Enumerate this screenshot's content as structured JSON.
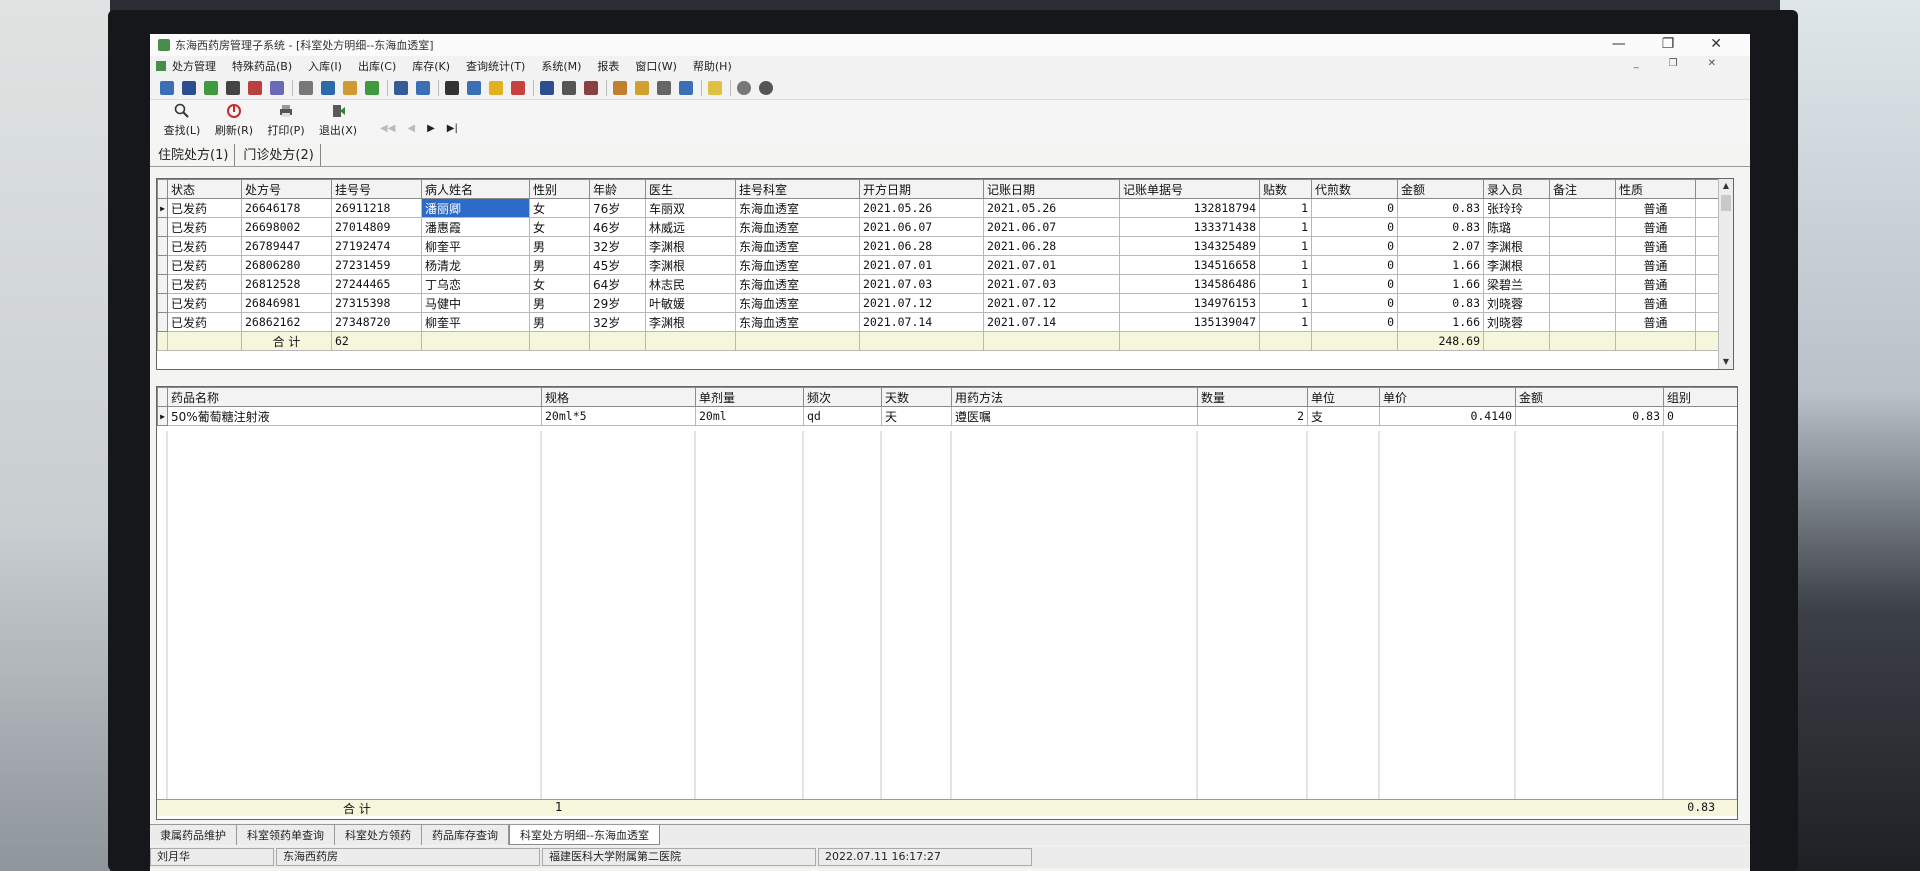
{
  "window": {
    "title": "东海西药房管理子系统 - [科室处方明细--东海血透室]"
  },
  "menu": [
    "处方管理",
    "特殊药品(B)",
    "入库(I)",
    "出库(C)",
    "库存(K)",
    "查询统计(T)",
    "系统(M)",
    "报表",
    "窗口(W)",
    "帮助(H)"
  ],
  "toolbar": {
    "find": "查找(L)",
    "refresh": "刷新(R)",
    "print": "打印(P)",
    "exit": "退出(X)"
  },
  "tabs": [
    "住院处方(1)",
    "门诊处方(2)"
  ],
  "prescriptions": {
    "headers": [
      "状态",
      "处方号",
      "挂号号",
      "病人姓名",
      "性别",
      "年龄",
      "医生",
      "挂号科室",
      "开方日期",
      "记账日期",
      "记账单据号",
      "贴数",
      "代煎数",
      "金额",
      "录入员",
      "备注",
      "性质"
    ],
    "rows": [
      [
        "已发药",
        "26646178",
        "26911218",
        "潘丽卿",
        "女",
        "76岁",
        "车丽双",
        "东海血透室",
        "2021.05.26",
        "2021.05.26",
        "132818794",
        "1",
        "0",
        "0.83",
        "张玲玲",
        "",
        "普通"
      ],
      [
        "已发药",
        "26698002",
        "27014809",
        "潘惠霞",
        "女",
        "46岁",
        "林威远",
        "东海血透室",
        "2021.06.07",
        "2021.06.07",
        "133371438",
        "1",
        "0",
        "0.83",
        "陈璐",
        "",
        "普通"
      ],
      [
        "已发药",
        "26789447",
        "27192474",
        "柳奎平",
        "男",
        "32岁",
        "李渊根",
        "东海血透室",
        "2021.06.28",
        "2021.06.28",
        "134325489",
        "1",
        "0",
        "2.07",
        "李渊根",
        "",
        "普通"
      ],
      [
        "已发药",
        "26806280",
        "27231459",
        "杨清龙",
        "男",
        "45岁",
        "李渊根",
        "东海血透室",
        "2021.07.01",
        "2021.07.01",
        "134516658",
        "1",
        "0",
        "1.66",
        "李渊根",
        "",
        "普通"
      ],
      [
        "已发药",
        "26812528",
        "27244465",
        "丁乌恋",
        "女",
        "64岁",
        "林志民",
        "东海血透室",
        "2021.07.03",
        "2021.07.03",
        "134586486",
        "1",
        "0",
        "1.66",
        "梁碧兰",
        "",
        "普通"
      ],
      [
        "已发药",
        "26846981",
        "27315398",
        "马健中",
        "男",
        "29岁",
        "叶敏媛",
        "东海血透室",
        "2021.07.12",
        "2021.07.12",
        "134976153",
        "1",
        "0",
        "0.83",
        "刘晓蓉",
        "",
        "普通"
      ],
      [
        "已发药",
        "26862162",
        "27348720",
        "柳奎平",
        "男",
        "32岁",
        "李渊根",
        "东海血透室",
        "2021.07.14",
        "2021.07.14",
        "135139047",
        "1",
        "0",
        "1.66",
        "刘晓蓉",
        "",
        "普通"
      ]
    ],
    "total_label": "合 计",
    "total_count": "62",
    "total_amount": "248.69"
  },
  "details": {
    "headers": [
      "药品名称",
      "规格",
      "单剂量",
      "频次",
      "天数",
      "用药方法",
      "数量",
      "单位",
      "单价",
      "金额",
      "组别"
    ],
    "rows": [
      [
        "50%葡萄糖注射液",
        "20ml*5",
        "20ml",
        "qd",
        "天",
        "遵医嘱",
        "2",
        "支",
        "0.4140",
        "0.83",
        "0"
      ]
    ],
    "total_label": "合 计",
    "total_count": "1",
    "total_amount": "0.83"
  },
  "bottom_tabs": [
    "隶属药品维护",
    "科室领药单查询",
    "科室处方领药",
    "药品库存查询",
    "科室处方明细--东海血透室"
  ],
  "status": [
    "刘月华",
    "东海西药房",
    "福建医科大学附属第二医院",
    "2022.07.11 16:17:27"
  ]
}
